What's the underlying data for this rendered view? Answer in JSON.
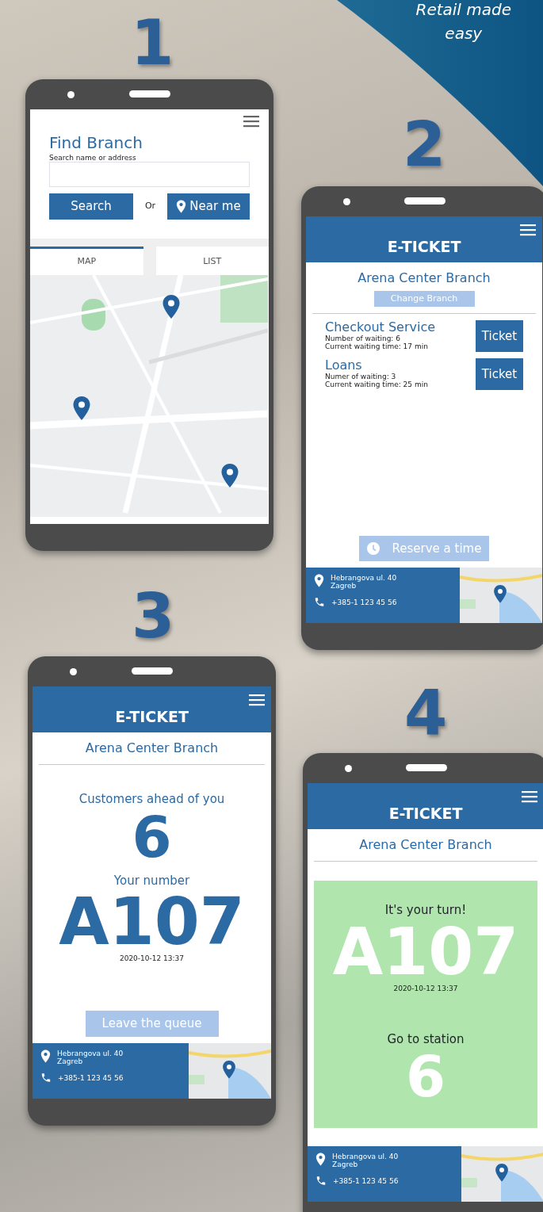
{
  "tagline": [
    "Retail made",
    "easy"
  ],
  "steps": [
    {
      "number": "1",
      "kind": "find",
      "title": "Find Branch",
      "search_label": "Search name or address",
      "search_button": "Search",
      "or_text": "Or",
      "near_button": "Near me",
      "tabs": [
        {
          "label": "MAP",
          "selected": true
        },
        {
          "label": "LIST",
          "selected": false
        }
      ]
    },
    {
      "number": "2",
      "kind": "services",
      "header": "E-TICKET",
      "branch": "Arena Center Branch",
      "change_button": {
        "label": "Change Branch",
        "disabled": true
      },
      "services": [
        {
          "name": "Checkout Service",
          "lines": [
            "Number of waiting: 6",
            "Current waiting time: 17 min"
          ],
          "button": "Ticket"
        },
        {
          "name": "Loans",
          "lines": [
            "Numer of waiting: 3",
            "Current waiting time: 25 min"
          ],
          "button": "Ticket"
        }
      ],
      "reserve_button": {
        "label": "Reserve a time",
        "disabled": true
      },
      "footer": {
        "address": "Hebrangova ul. 40\nZagreb",
        "phone": "+385-1 123 45 56"
      }
    },
    {
      "number": "3",
      "kind": "queue",
      "header": "E-TICKET",
      "branch": "Arena Center Branch",
      "ahead_label": "Customers ahead of you",
      "ahead_count": "6",
      "number_label": "Your number",
      "ticket": "A107",
      "timestamp": "2020-10-12 13:37",
      "leave_button": {
        "label": "Leave the queue",
        "disabled": true
      },
      "footer": {
        "address": "Hebrangova ul. 40\nZagreb",
        "phone": "+385-1 123 45 56"
      }
    },
    {
      "number": "4",
      "kind": "turn",
      "header": "E-TICKET",
      "branch": "Arena Center Branch",
      "turn_label": "It's your turn!",
      "ticket": "A107",
      "timestamp": "2020-10-12 13:37",
      "station_label": "Go to station",
      "station": "6",
      "footer": {
        "address": "Hebrangova ul. 40\nZagreb",
        "phone": "+385-1 123 45 56"
      }
    }
  ]
}
